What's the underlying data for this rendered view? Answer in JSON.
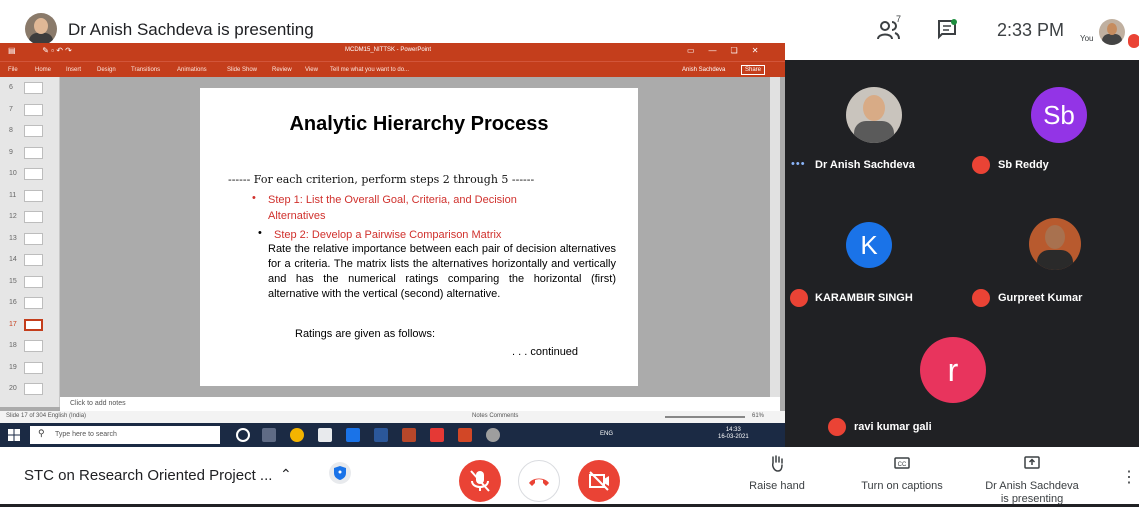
{
  "header": {
    "presenting_title": "Dr Anish Sachdeva is presenting",
    "people_count": "7",
    "time": "2:33 PM",
    "self_label": "You"
  },
  "powerpoint": {
    "doc_title": "MCDM15_NITTSK - PowerPoint",
    "user_name": "Anish Sachdeva",
    "share_label": "Share",
    "ribbon_tabs": [
      "File",
      "Home",
      "Insert",
      "Design",
      "Transitions",
      "Animations",
      "Slide Show",
      "Review",
      "View",
      "Tell me what you want to do..."
    ],
    "thumbnail_numbers": [
      "6",
      "7",
      "8",
      "9",
      "10",
      "11",
      "12",
      "13",
      "14",
      "15",
      "16",
      "17",
      "18",
      "19",
      "20"
    ],
    "active_slide": "17",
    "notes_placeholder": "Click to add notes",
    "status_left": "Slide 17 of 304    English (India)",
    "status_right": "Notes    Comments",
    "zoom": "61%"
  },
  "slide": {
    "title": "Analytic Hierarchy Process",
    "subhead": "------ For each criterion, perform steps 2 through 5 ------",
    "step1_line1": "Step 1:  List the Overall Goal, Criteria, and Decision",
    "step1_line2": "Alternatives",
    "step2": "Step 2:  Develop a Pairwise Comparison Matrix",
    "rate_para": "Rate the relative importance between each pair of decision alternatives for a criteria.  The matrix lists the alternatives horizontally and vertically and has the numerical ratings comparing the horizontal (first) alternative with the vertical (second) alternative.",
    "ratings_line": "Ratings are given as follows:",
    "continued": ". . . continued"
  },
  "taskbar": {
    "search_placeholder": "Type here to search",
    "tray": "ENG",
    "clock_time": "14:33",
    "clock_date": "16-03-2021"
  },
  "participants": [
    {
      "name": "Dr Anish Sachdeva"
    },
    {
      "name": "Sb Reddy",
      "initials": "Sb",
      "color": "#9334e6"
    },
    {
      "name": "KARAMBIR SINGH",
      "initials": "K",
      "color": "#1a73e8"
    },
    {
      "name": "Gurpreet Kumar"
    },
    {
      "name": "ravi kumar gali",
      "initials": "r",
      "color": "#e8345d"
    }
  ],
  "bottom": {
    "meeting_title": "STC on Research Oriented Project ...",
    "raise_hand": "Raise hand",
    "captions": "Turn on captions",
    "presenting_line1": "Dr Anish Sachdeva",
    "presenting_line2": "is presenting"
  },
  "colors": {
    "mute_red": "#ea4335",
    "ppt_orange": "#c43e1c"
  }
}
